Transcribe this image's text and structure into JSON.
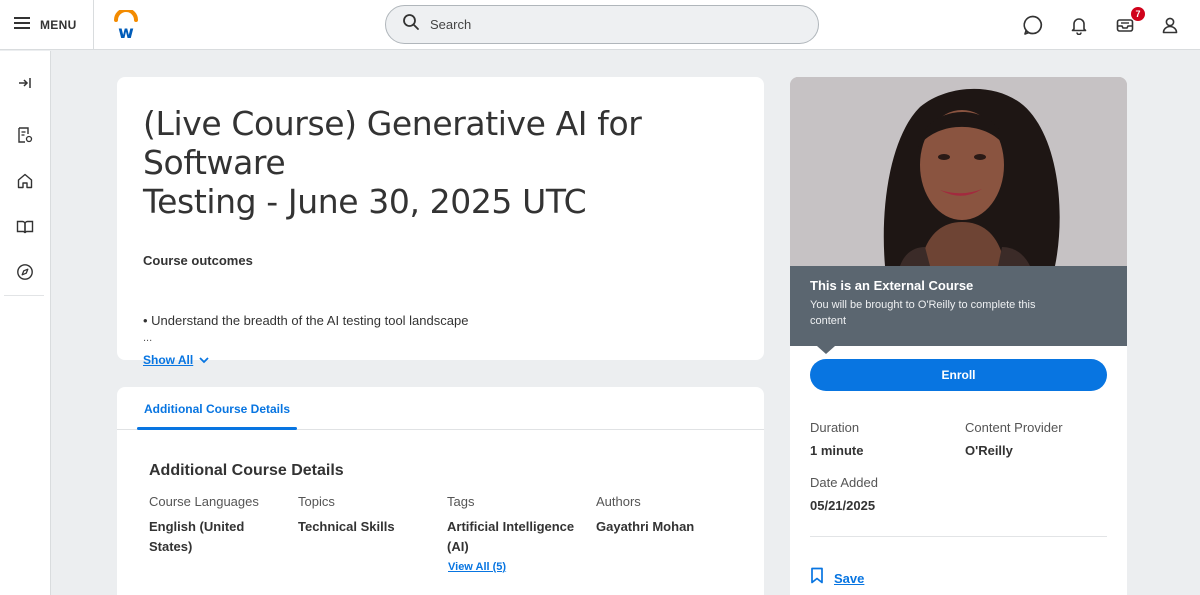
{
  "header": {
    "menu_label": "MENU",
    "search_placeholder": "Search",
    "inbox_badge_count": "7",
    "icons": [
      "menu-icon",
      "workday-logo",
      "search-icon",
      "chat-icon",
      "bell-icon",
      "inbox-icon",
      "profile-icon"
    ]
  },
  "rail": {
    "icons": [
      "expand-rail-icon",
      "learning-record-icon",
      "home-icon",
      "library-icon",
      "discover-icon"
    ]
  },
  "course": {
    "title_line1": "(Live Course) Generative AI for Software",
    "title_line2": "Testing - June 30, 2025 UTC",
    "outcomes_heading": "Course outcomes",
    "outcome_1": "• Understand the breadth of the AI testing tool landscape",
    "ellipsis": "...",
    "show_all": "Show All"
  },
  "details": {
    "tab_label": "Additional Course Details",
    "heading": "Additional Course Details",
    "languages_label": "Course Languages",
    "languages_value_1": "English (United",
    "languages_value_2": "States)",
    "topics_label": "Topics",
    "topics_value": "Technical Skills",
    "tags_label": "Tags",
    "tags_value_1": "Artificial Intelligence",
    "tags_value_2": "(AI)",
    "view_all": "View All (5)",
    "authors_label": "Authors",
    "authors_value": "Gayathri Mohan"
  },
  "side": {
    "external_title": "This is an External Course",
    "external_text_1": "You will be brought to O'Reilly to complete this",
    "external_text_2": "content",
    "enroll_label": "Enroll",
    "duration_label": "Duration",
    "duration_value": "1 minute",
    "provider_label": "Content Provider",
    "provider_value": "O'Reilly",
    "date_label": "Date Added",
    "date_value": "05/21/2025",
    "save_label": "Save"
  },
  "colors": {
    "accent": "#0875e1",
    "banner": "#5b6670",
    "badge": "#d0021b",
    "logo_orange": "#f38b00",
    "logo_blue": "#005cb9"
  }
}
